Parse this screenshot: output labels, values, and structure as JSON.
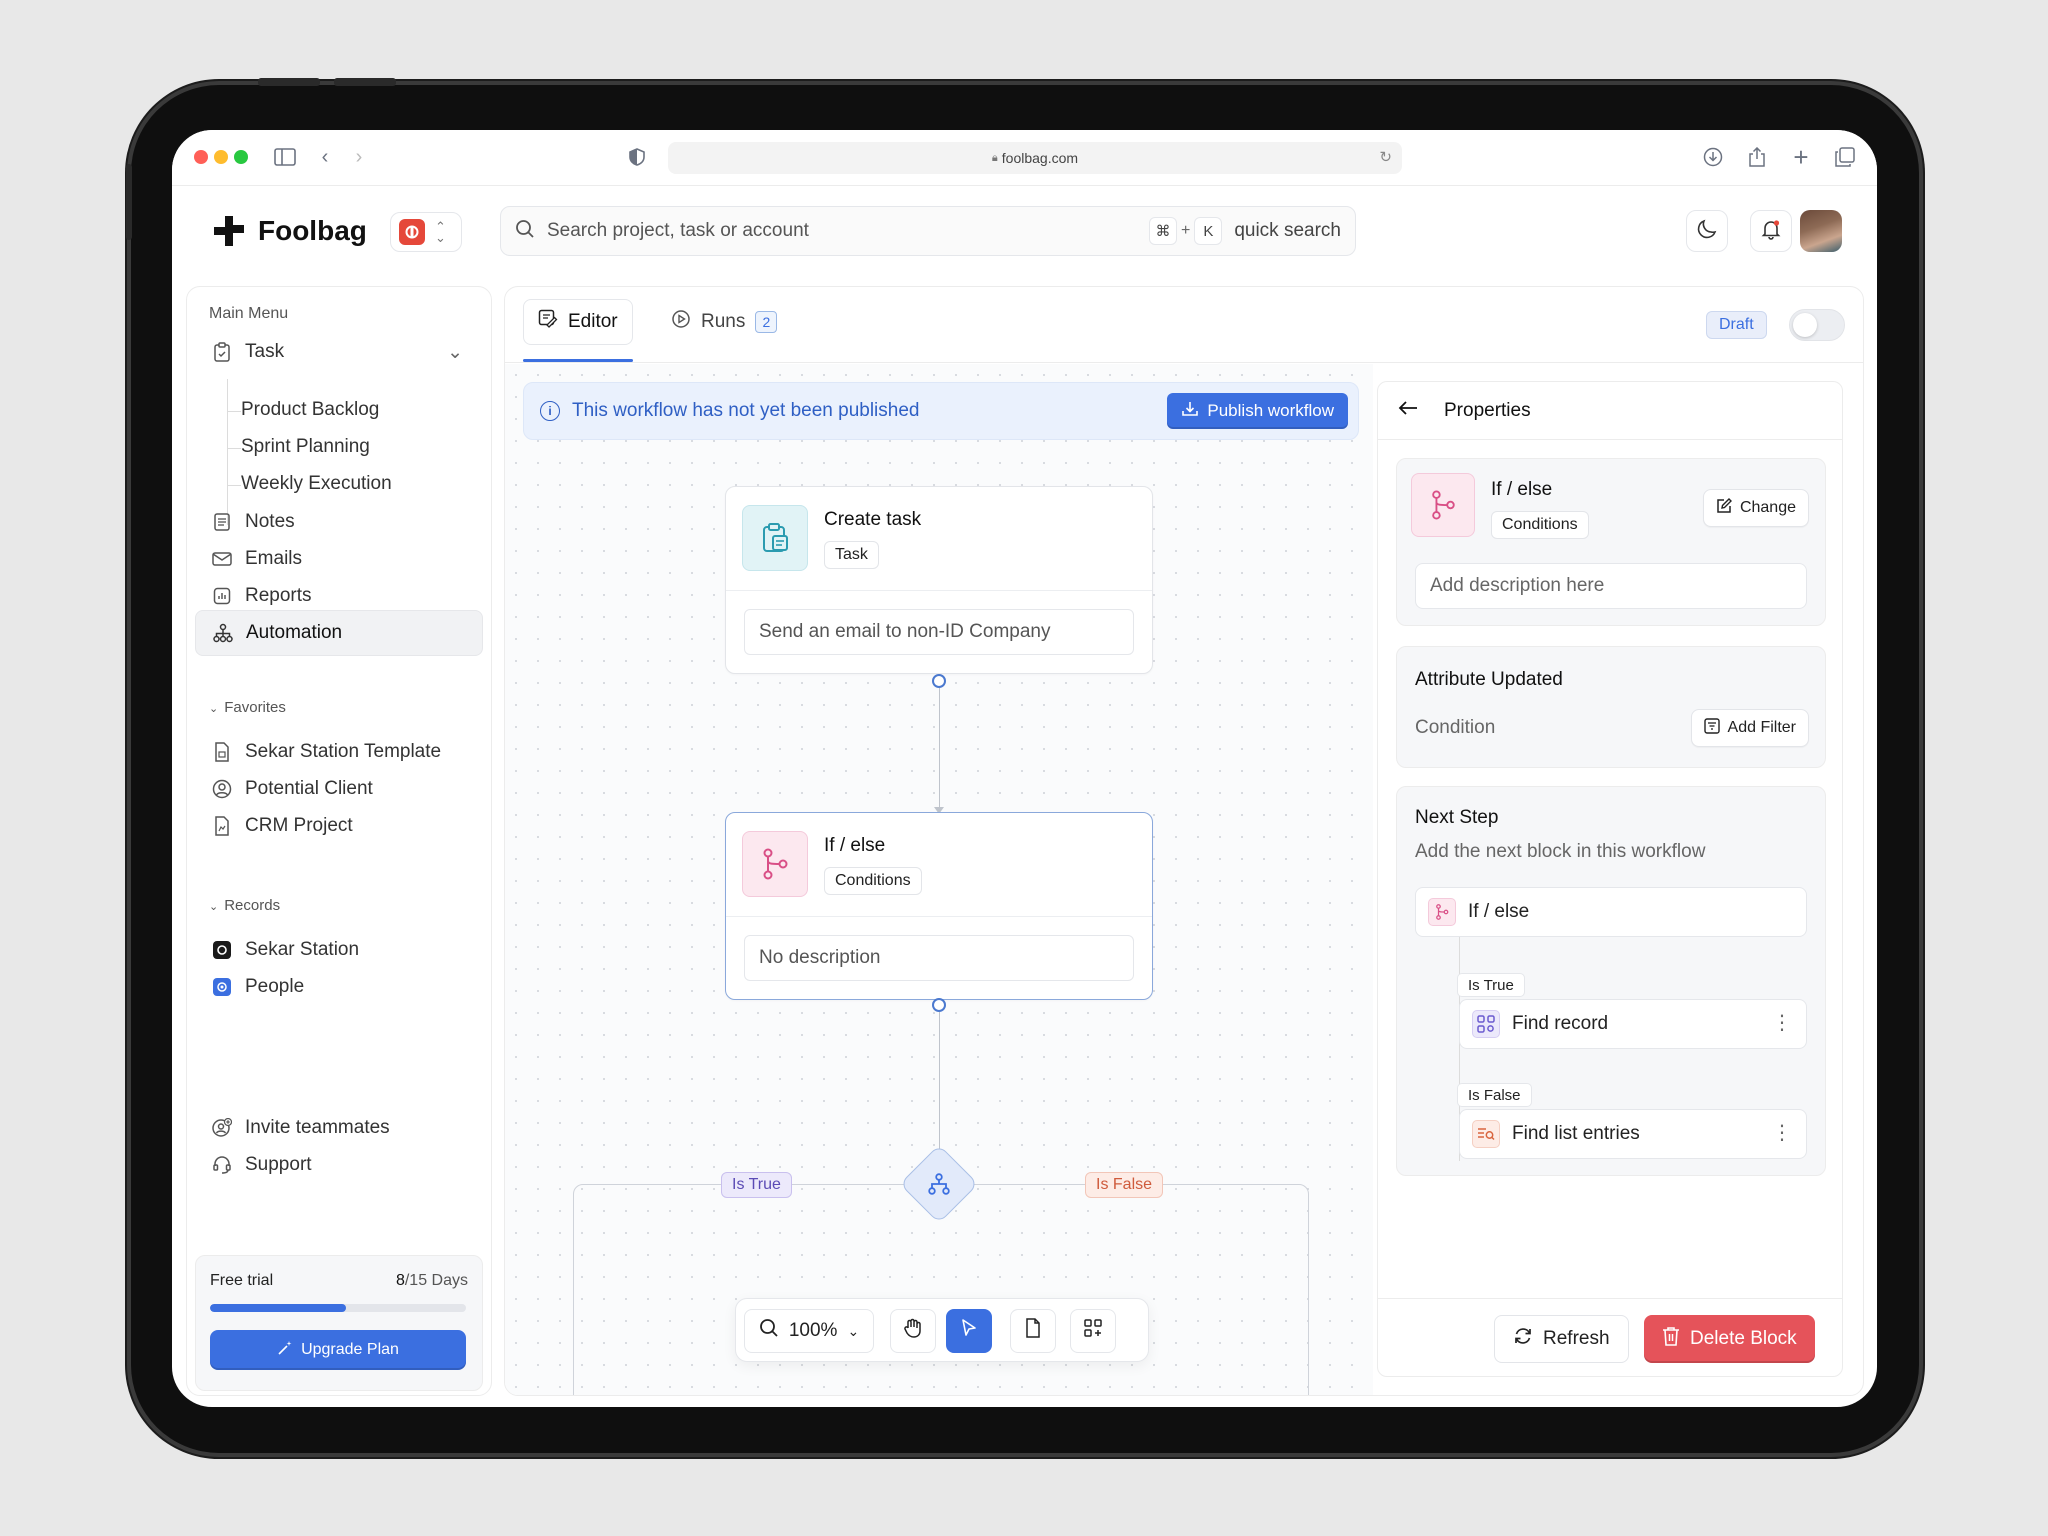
{
  "browser": {
    "url": "foolbag.com",
    "dots": [
      "#ff5f57",
      "#febc2e",
      "#28c840"
    ]
  },
  "header": {
    "logo_text": "Foolbag",
    "search_placeholder": "Search project, task or account",
    "shortcut_key1": "⌘",
    "shortcut_plus": "+",
    "shortcut_key2": "K",
    "quick_search": "quick search"
  },
  "sidebar": {
    "main_menu_label": "Main Menu",
    "task_label": "Task",
    "task_children": [
      "Product Backlog",
      "Sprint Planning",
      "Weekly Execution"
    ],
    "items": [
      "Notes",
      "Emails",
      "Reports",
      "Automation"
    ],
    "favorites_label": "Favorites",
    "favorites": [
      "Sekar Station Template",
      "Potential Client",
      "CRM Project"
    ],
    "records_label": "Records",
    "records": [
      "Sekar Station",
      "People"
    ],
    "invite": "Invite teammates",
    "support": "Support",
    "trial": {
      "label": "Free trial",
      "used": "8",
      "total": "/15 Days",
      "progress": 0.53,
      "button": "Upgrade Plan"
    }
  },
  "tabs": {
    "editor": "Editor",
    "runs": "Runs",
    "runs_count": "2",
    "status": "Draft"
  },
  "canvas": {
    "banner_text": "This workflow has not yet been published",
    "publish_button": "Publish workflow",
    "node1": {
      "title": "Create task",
      "tag": "Task",
      "description": "Send an email to non-ID Company"
    },
    "node2": {
      "title": "If / else",
      "tag": "Conditions",
      "description": "No description"
    },
    "branch_true": "Is True",
    "branch_false": "Is False",
    "zoom": "100%"
  },
  "properties": {
    "title": "Properties",
    "block_title": "If / else",
    "block_tag": "Conditions",
    "change_button": "Change",
    "description_placeholder": "Add description here",
    "attribute_title": "Attribute Updated",
    "condition_label": "Condition",
    "add_filter_button": "Add Filter",
    "next_step_title": "Next Step",
    "next_step_sub": "Add the next block in this workflow",
    "next_block": "If / else",
    "true_tag": "Is True",
    "true_block": "Find record",
    "false_tag": "Is False",
    "false_block": "Find list entries",
    "refresh_button": "Refresh",
    "delete_button": "Delete Block"
  },
  "colors": {
    "accent": "#3b6fe0",
    "danger": "#e5535a",
    "pink_icon": "#d94f86",
    "teal_icon": "#2b9bb0"
  }
}
